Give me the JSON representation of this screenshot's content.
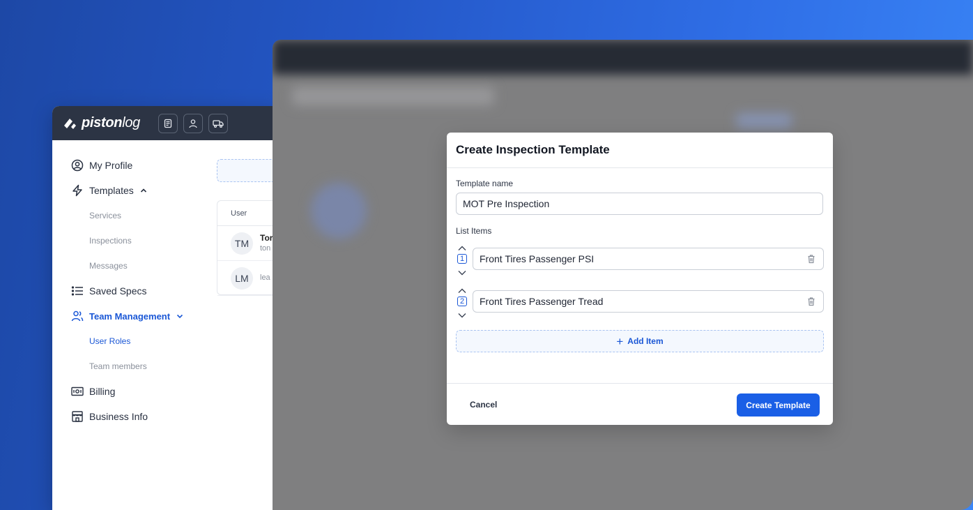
{
  "app": {
    "logo_bold": "piston",
    "logo_light": "log",
    "header_icons": [
      "document-icon",
      "user-icon",
      "truck-icon"
    ]
  },
  "sidebar": {
    "items": [
      {
        "label": "My Profile",
        "icon": "user-circle-icon"
      },
      {
        "label": "Templates",
        "icon": "lightning-icon",
        "expanded": true
      },
      {
        "label": "Services",
        "sub": true
      },
      {
        "label": "Inspections",
        "sub": true
      },
      {
        "label": "Messages",
        "sub": true
      },
      {
        "label": "Saved Specs",
        "icon": "list-icon"
      },
      {
        "label": "Team Management",
        "icon": "users-icon",
        "expanded": true,
        "active": true
      },
      {
        "label": "User Roles",
        "sub": true,
        "active": true
      },
      {
        "label": "Team members",
        "sub": true
      },
      {
        "label": "Billing",
        "icon": "money-icon"
      },
      {
        "label": "Business Info",
        "icon": "store-icon"
      }
    ]
  },
  "table": {
    "header": "User",
    "rows": [
      {
        "initials": "TM",
        "name": "Tor",
        "email": "ton"
      },
      {
        "initials": "LM",
        "name": "",
        "email": "lea"
      }
    ]
  },
  "modal": {
    "title": "Create Inspection Template",
    "template_name_label": "Template name",
    "template_name_value": "MOT Pre Inspection",
    "list_items_label": "List Items",
    "items": [
      {
        "number": "1",
        "value": "Front Tires Passenger PSI"
      },
      {
        "number": "2",
        "value": "Front Tires Passenger Tread"
      }
    ],
    "add_item_label": "Add Item",
    "cancel_label": "Cancel",
    "create_label": "Create Template"
  },
  "colors": {
    "accent": "#1a5fe6",
    "header_bg": "#2c3444",
    "background_gradient_start": "#1d48a6",
    "background_gradient_end": "#3a86f7"
  }
}
